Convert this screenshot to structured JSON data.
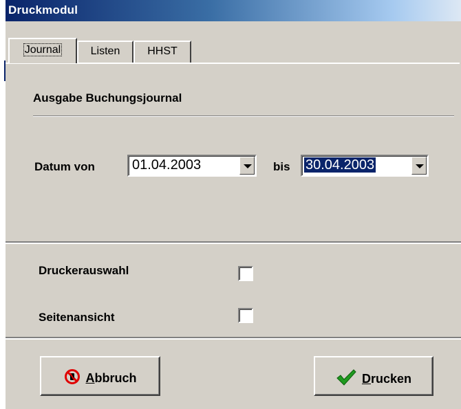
{
  "window": {
    "title": "Druckmodul"
  },
  "tabs": [
    {
      "label": "Journal",
      "active": true
    },
    {
      "label": "Listen",
      "active": false
    },
    {
      "label": "HHST",
      "active": false
    }
  ],
  "journal": {
    "section_title": "Ausgabe Buchungsjournal",
    "date_from_label": "Datum von",
    "date_from_value": "01.04.2003",
    "date_to_label": "bis",
    "date_to_value": "30.04.2003"
  },
  "options": {
    "printer_select_label": "Druckerauswahl",
    "printer_select_checked": false,
    "preview_label": "Seitenansicht",
    "preview_checked": false
  },
  "buttons": {
    "cancel_mnemonic": "A",
    "cancel_rest": "bbruch",
    "print_mnemonic": "D",
    "print_rest": "rucken"
  },
  "icons": {
    "cancel": "no-entry-icon",
    "print": "checkmark-icon"
  },
  "colors": {
    "titlebar_start": "#0a246a",
    "dialog_face": "#d4d0c8",
    "cancel_icon_red": "#e00000",
    "check_green": "#1f9a1f"
  }
}
